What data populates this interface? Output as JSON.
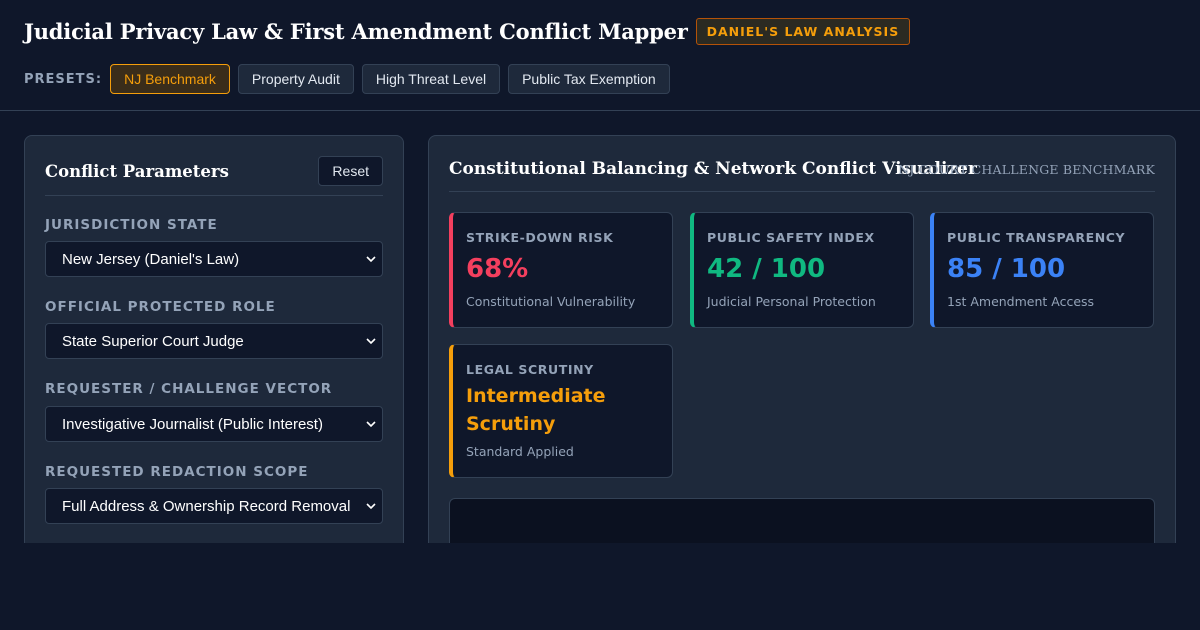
{
  "header": {
    "title": "Judicial Privacy Law & First Amendment Conflict Mapper",
    "badge": "DANIEL'S LAW ANALYSIS"
  },
  "presets": {
    "label": "PRESETS:",
    "items": [
      {
        "label": "NJ Benchmark",
        "active": true
      },
      {
        "label": "Property Audit",
        "active": false
      },
      {
        "label": "High Threat Level",
        "active": false
      },
      {
        "label": "Public Tax Exemption",
        "active": false
      }
    ]
  },
  "params": {
    "title": "Conflict Parameters",
    "reset_label": "Reset",
    "fields": [
      {
        "label": "JURISDICTION STATE",
        "value": "New Jersey (Daniel's Law)"
      },
      {
        "label": "OFFICIAL PROTECTED ROLE",
        "value": "State Superior Court Judge"
      },
      {
        "label": "REQUESTER / CHALLENGE VECTOR",
        "value": "Investigative Journalist (Public Interest)"
      },
      {
        "label": "REQUESTED REDACTION SCOPE",
        "value": "Full Address & Ownership Record Removal"
      }
    ]
  },
  "visualizer": {
    "title": "Constitutional Balancing & Network Conflict Visualizer",
    "subtitle": "NJ COURT CHALLENGE BENCHMARK",
    "metrics": [
      {
        "label": "STRIKE-DOWN RISK",
        "value": "68%",
        "desc": "Constitutional Vulnerability",
        "color": "#f43f5e"
      },
      {
        "label": "PUBLIC SAFETY INDEX",
        "value": "42 / 100",
        "desc": "Judicial Personal Protection",
        "color": "#10b981"
      },
      {
        "label": "PUBLIC TRANSPARENCY",
        "value": "85 / 100",
        "desc": "1st Amendment Access",
        "color": "#3b82f6"
      },
      {
        "label": "LEGAL SCRUTINY",
        "value": "Intermediate Scrutiny",
        "desc": "Standard Applied",
        "color": "#f59e0b"
      }
    ]
  },
  "icons": {
    "select_chevron": "chevron-down-icon"
  }
}
